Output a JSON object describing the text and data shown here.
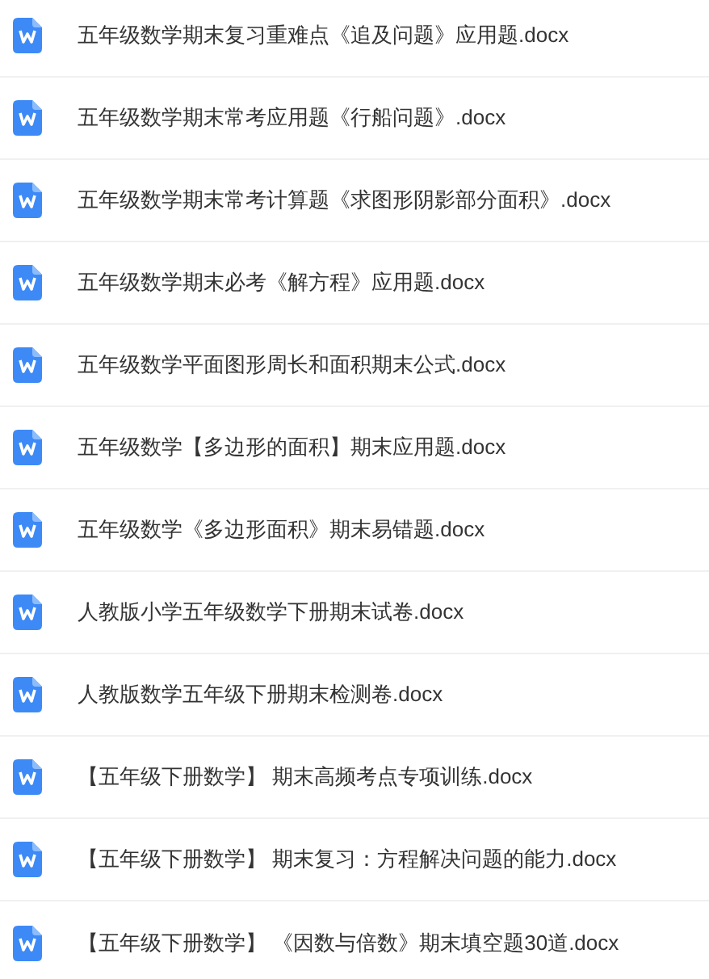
{
  "files": [
    {
      "name": "五年级数学期末复习重难点《追及问题》应用题.docx"
    },
    {
      "name": "五年级数学期末常考应用题《行船问题》.docx"
    },
    {
      "name": "五年级数学期末常考计算题《求图形阴影部分面积》.docx"
    },
    {
      "name": "五年级数学期末必考《解方程》应用题.docx"
    },
    {
      "name": "五年级数学平面图形周长和面积期末公式.docx"
    },
    {
      "name": "五年级数学【多边形的面积】期末应用题.docx"
    },
    {
      "name": "五年级数学《多边形面积》期末易错题.docx"
    },
    {
      "name": "人教版小学五年级数学下册期末试卷.docx"
    },
    {
      "name": "人教版数学五年级下册期末检测卷.docx"
    },
    {
      "name": "【五年级下册数学】 期末高频考点专项训练.docx"
    },
    {
      "name": "【五年级下册数学】 期末复习：方程解决问题的能力.docx"
    },
    {
      "name": "【五年级下册数学】 《因数与倍数》期末填空题30道.docx"
    }
  ]
}
